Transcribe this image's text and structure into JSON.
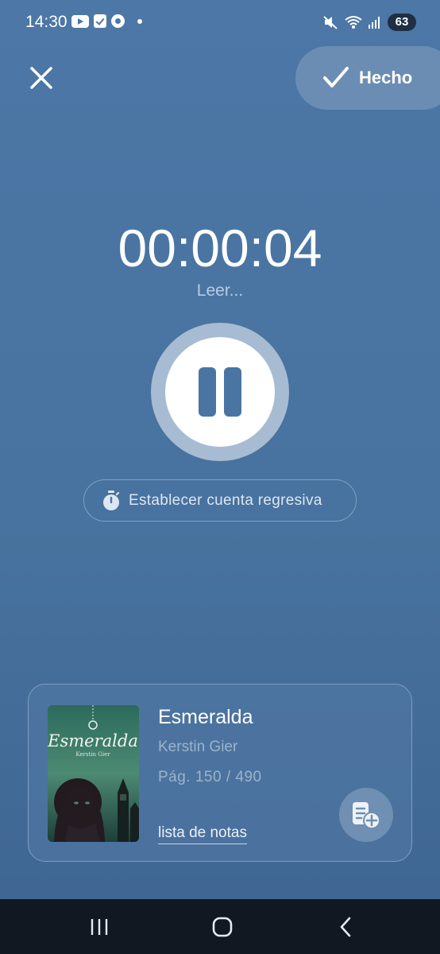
{
  "status_bar": {
    "time": "14:30",
    "battery": "63"
  },
  "header": {
    "done_label": "Hecho"
  },
  "timer": {
    "elapsed": "00:00:04",
    "activity": "Leer..."
  },
  "countdown": {
    "label": "Establecer cuenta regresiva"
  },
  "book": {
    "title": "Esmeralda",
    "author": "Kerstin Gier",
    "pages": "Pág. 150 / 490",
    "notes_link": "lista de notas",
    "cover": {
      "title": "Esmeralda",
      "author": "Kerstin Gier"
    }
  },
  "colors": {
    "background": "#4c77a6",
    "accent_white": "#ffffff",
    "muted_text": "#9db3ca",
    "nav_bar": "#111822"
  },
  "icons": [
    "close-icon",
    "checkmark-icon",
    "pause-icon",
    "stopwatch-icon",
    "add-note-icon",
    "recents-icon",
    "home-icon",
    "back-icon"
  ]
}
